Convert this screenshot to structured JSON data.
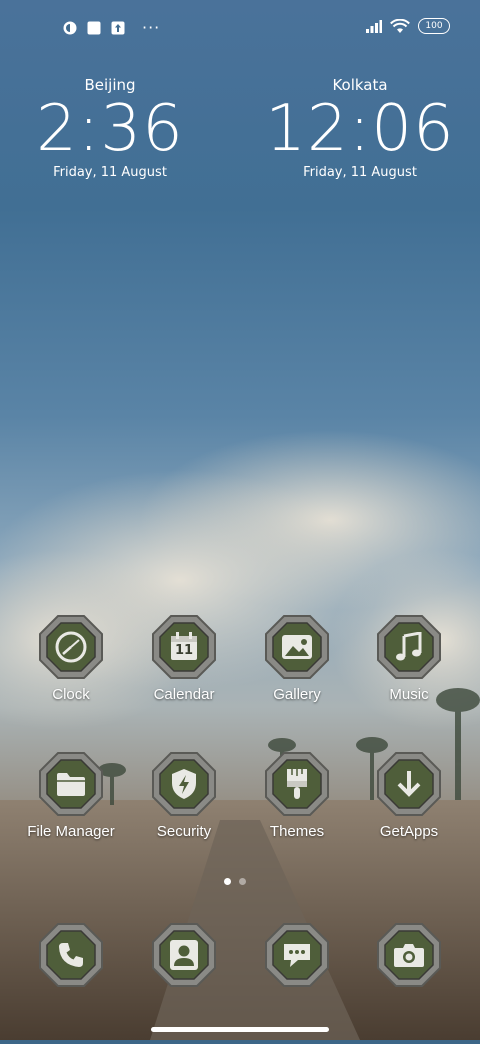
{
  "status_bar": {
    "left_icons": [
      "app-notif-icon",
      "square-notif-icon",
      "upload-notif-icon"
    ],
    "more": "···",
    "battery": "100",
    "right_icons": [
      "signal-icon",
      "wifi-icon",
      "battery-icon"
    ]
  },
  "clocks": [
    {
      "city": "Beijing",
      "time": "2:36",
      "date": "Friday, 11 August"
    },
    {
      "city": "Kolkata",
      "time": "12:06",
      "date": "Friday, 11 August"
    }
  ],
  "apps_row1": [
    {
      "label": "Clock",
      "icon": "clock-icon"
    },
    {
      "label": "Calendar",
      "icon": "calendar-icon",
      "badge": "11"
    },
    {
      "label": "Gallery",
      "icon": "gallery-icon"
    },
    {
      "label": "Music",
      "icon": "music-icon"
    }
  ],
  "apps_row2": [
    {
      "label": "File Manager",
      "icon": "folder-icon"
    },
    {
      "label": "Security",
      "icon": "shield-icon"
    },
    {
      "label": "Themes",
      "icon": "brush-icon"
    },
    {
      "label": "GetApps",
      "icon": "download-icon"
    }
  ],
  "dock": [
    {
      "icon": "phone-icon"
    },
    {
      "icon": "contacts-icon"
    },
    {
      "icon": "messages-icon"
    },
    {
      "icon": "camera-icon"
    }
  ],
  "page_indicator": {
    "pages": 2,
    "active": 1
  },
  "colors": {
    "tile_frame": "#8a8a86",
    "tile_fill": "#4f5e3a",
    "tile_glyph": "#e9e9e4"
  }
}
